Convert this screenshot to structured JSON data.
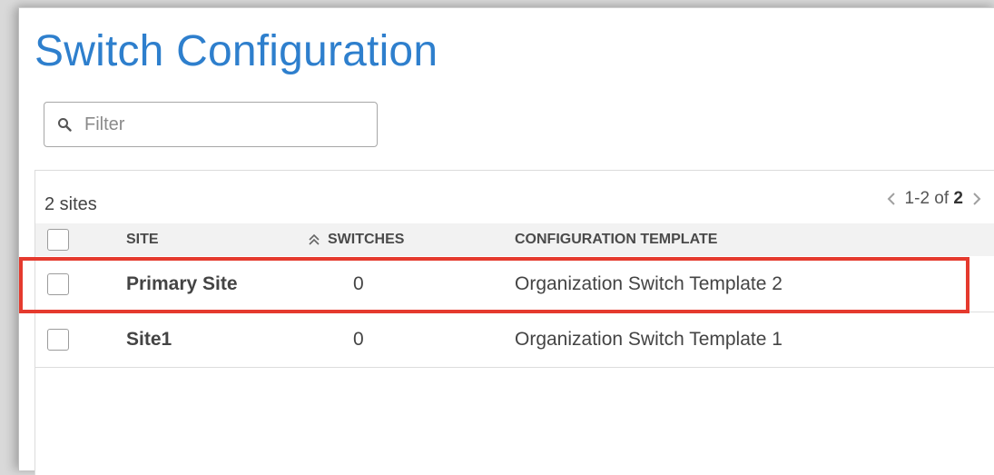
{
  "page": {
    "title": "Switch Configuration"
  },
  "filter": {
    "placeholder": "Filter"
  },
  "table": {
    "count_label": "2 sites",
    "pagination": {
      "range": "1-2 of",
      "total": "2"
    },
    "columns": {
      "site": "SITE",
      "switches": "SWITCHES",
      "template": "CONFIGURATION TEMPLATE"
    },
    "rows": [
      {
        "site": "Primary Site",
        "switches": "0",
        "template": "Organization Switch Template 2"
      },
      {
        "site": "Site1",
        "switches": "0",
        "template": "Organization Switch Template 1"
      }
    ]
  },
  "colors": {
    "title": "#2e7fcd",
    "highlight": "#e53a2e"
  }
}
